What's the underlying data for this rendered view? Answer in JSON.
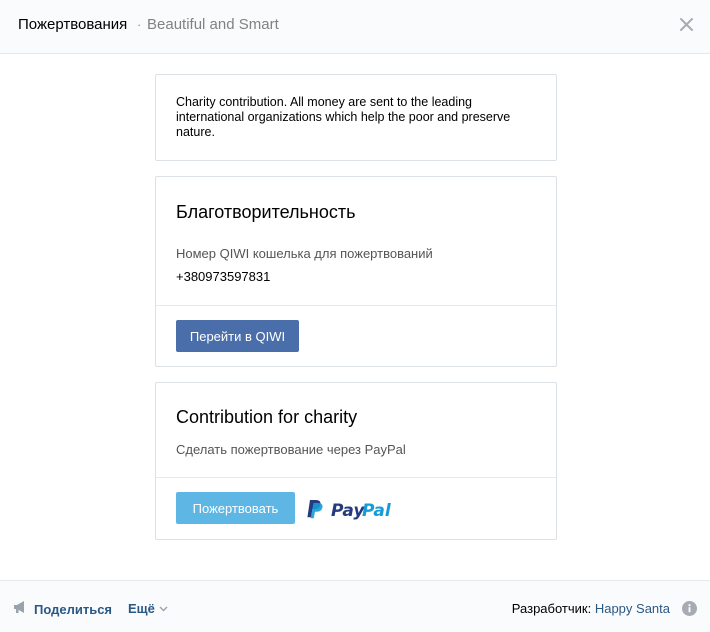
{
  "header": {
    "title": "Пожертвования",
    "separator": "·",
    "subtitle": "Beautiful and Smart",
    "close_icon": "close-icon"
  },
  "info_card": {
    "text": "Charity contribution. All money are sent to the leading international organizations which help the poor and preserve nature."
  },
  "qiwi_card": {
    "title": "Благотворительность",
    "description": "Номер QIWI кошелька для пожертвований",
    "wallet_number": "+380973597831",
    "button_label": "Перейти в QIWI",
    "button_color": "#4a6ea9"
  },
  "paypal_card": {
    "title": "Contribution for charity",
    "description": "Сделать пожертвование через PayPal",
    "button_label": "Пожертвовать",
    "button_color": "#5eb6e4",
    "logo_text": "PayPal"
  },
  "footer": {
    "share_label": "Поделиться",
    "share_icon": "megaphone-icon",
    "more_label": "Ещё",
    "more_icon": "chevron-down-icon",
    "developer_label": "Разработчик:",
    "developer_name": "Happy Santa",
    "info_icon": "info-icon",
    "link_color": "#2a5885"
  }
}
